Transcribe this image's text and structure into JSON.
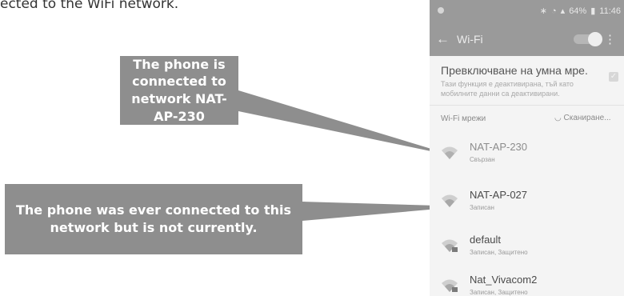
{
  "page": {
    "intro_text": "ected to the WiFi network."
  },
  "callouts": {
    "connected": "The phone is connected to network NAT-AP-230",
    "saved": "The phone was ever connected to this network but is not currently."
  },
  "phone": {
    "status_bar": {
      "battery": "64%",
      "time": "11:46"
    },
    "app_bar": {
      "title": "Wi-Fi",
      "wifi_enabled": true
    },
    "smart_switch": {
      "title": "Превключване на умна мре.",
      "description": "Тази функция е деактивирана, тъй като мобилните данни са деактивирани."
    },
    "networks_section": {
      "label": "Wi-Fi мрежи",
      "scan_label": "Сканиране..."
    },
    "networks": [
      {
        "name": "NAT-AP-230",
        "status": "Свързан",
        "icon": "wifi-icon",
        "secured": false
      },
      {
        "name": "NAT-AP-027",
        "status": "Записан",
        "icon": "wifi-icon",
        "secured": false
      },
      {
        "name": "default",
        "status": "Записан, Защитено",
        "icon": "wifi-lock-icon",
        "secured": true
      },
      {
        "name": "Nat_Vivacom2",
        "status": "Записан, Защитено",
        "icon": "wifi-lock-icon",
        "secured": true
      }
    ]
  },
  "colors": {
    "callout_bg": "#8e8e8e",
    "phone_header": "#9a9a9a",
    "phone_bg": "#f4f4f4"
  }
}
